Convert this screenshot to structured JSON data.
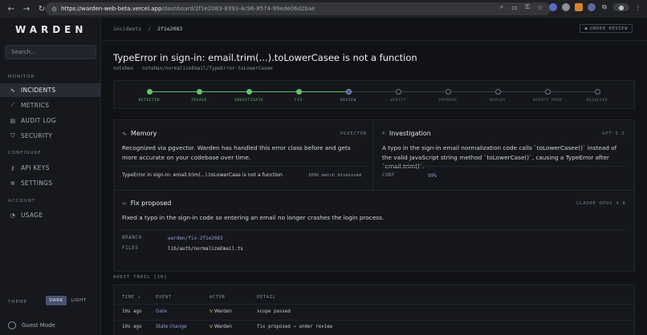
{
  "browser": {
    "url_host": "https://warden-web-beta.vercel.app",
    "url_path": "/dashboard/2f1e2083-8393-4c96-8574-99ede06d2bae"
  },
  "sidebar": {
    "logo": "WARDEN",
    "search_placeholder": "Search...",
    "monitor_label": "MONITOR",
    "configure_label": "CONFIGURE",
    "account_label": "ACCOUNT",
    "items": [
      {
        "label": "INCIDENTS",
        "icon": "pulse-icon"
      },
      {
        "label": "METRICS",
        "icon": "chart-icon"
      },
      {
        "label": "AUDIT LOG",
        "icon": "list-icon"
      },
      {
        "label": "SECURITY",
        "icon": "shield-icon"
      },
      {
        "label": "API KEYS",
        "icon": "key-icon"
      },
      {
        "label": "SETTINGS",
        "icon": "gear-icon"
      },
      {
        "label": "USAGE",
        "icon": "gauge-icon"
      }
    ],
    "theme_label": "THEME",
    "theme_dark": "DARK",
    "theme_light": "LIGHT",
    "guest": "Guest Mode"
  },
  "header": {
    "crumb_root": "incidents",
    "crumb_sep": "/",
    "crumb_current": "2f1e2083",
    "badge": "UNDER REVIEW",
    "title": "TypeError in sign-in: email.trim(...).toLowerCasee is not a function",
    "subtitle": "notehex · notehex/normalizeEmail/TypeError-toLowerCasee"
  },
  "stepper": {
    "steps": [
      {
        "label": "DETECTED",
        "state": "done"
      },
      {
        "label": "TRIAGE",
        "state": "done"
      },
      {
        "label": "INVESTIGATE",
        "state": "done"
      },
      {
        "label": "FIX",
        "state": "done"
      },
      {
        "label": "REVIEW",
        "state": "current"
      },
      {
        "label": "VERIFY",
        "state": "todo"
      },
      {
        "label": "APPROVE",
        "state": "todo"
      },
      {
        "label": "DEPLOY",
        "state": "todo"
      },
      {
        "label": "VERIFY PROD",
        "state": "todo"
      },
      {
        "label": "RESOLVED",
        "state": "todo"
      }
    ]
  },
  "memory": {
    "title": "Memory",
    "tag": "PGVECTOR",
    "text": "Recognized via pgvector. Warden has handled this error class before and gets more accurate on your codebase over time.",
    "match_title": "TypeError in sign-in: email.trim(...).toLowerCase is not a function",
    "match_meta": "100% match  dismissed"
  },
  "investigation": {
    "title": "Investigation",
    "tag": "GPT-5.5",
    "text": "A typo in the sign-in email normalization code calls `toLowerCasee()` instead of the valid JavaScript string method `toLowerCase()`, causing a TypeError after `email.trim()`.",
    "conf_label": "CONF",
    "conf_value": "99%"
  },
  "fix": {
    "title": "Fix proposed",
    "tag": "CLAUDE OPUS 4.8",
    "text": "Fixed a typo in the sign-in code so entering an email no longer crashes the login process.",
    "branch_label": "BRANCH",
    "branch_value": "warden/fix-2f1e2083",
    "files_label": "FILES",
    "files_value": "lib/auth/normalizeEmail.ts"
  },
  "audit": {
    "label": "AUDIT TRAIL [10]",
    "headers": {
      "time": "TIME ↓",
      "event": "EVENT",
      "actor": "ACTOR",
      "detail": "DETAIL"
    },
    "rows": [
      {
        "time": "10s ago",
        "event": "Gate",
        "actor": "Warden",
        "detail": "scope passed"
      },
      {
        "time": "10s ago",
        "event": "State change",
        "actor": "Warden",
        "detail": "fix proposed → under review"
      }
    ]
  },
  "colors": {
    "done": "#62c36a",
    "current": "#8896c0",
    "accent_blue": "#8ea0d6",
    "warden_mark": "#e7c35a"
  }
}
